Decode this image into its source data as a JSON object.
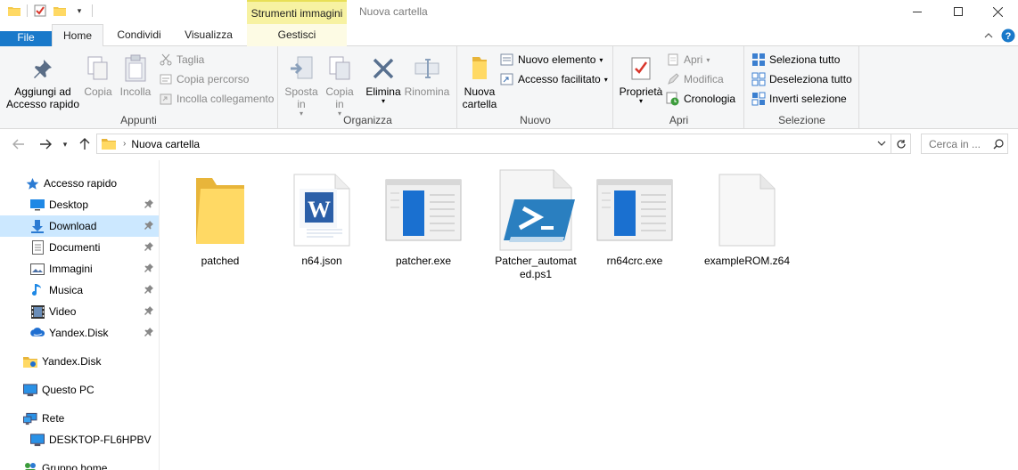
{
  "window": {
    "title": "Nuova cartella",
    "context_tab_header": "Strumenti immagini"
  },
  "tabs": [
    {
      "label": "File"
    },
    {
      "label": "Home"
    },
    {
      "label": "Condividi"
    },
    {
      "label": "Visualizza"
    },
    {
      "label": "Gestisci"
    }
  ],
  "ribbon": {
    "appunti": {
      "label": "Appunti",
      "pin": "Aggiungi ad Accesso rapido",
      "copy": "Copia",
      "paste": "Incolla",
      "cut": "Taglia",
      "copy_path": "Copia percorso",
      "paste_link": "Incolla collegamento"
    },
    "organizza": {
      "label": "Organizza",
      "move_to": "Sposta in",
      "copy_to": "Copia in",
      "delete": "Elimina",
      "rename": "Rinomina"
    },
    "nuovo": {
      "label": "Nuovo",
      "new_folder": "Nuova cartella",
      "new_item": "Nuovo elemento",
      "easy_access": "Accesso facilitato"
    },
    "apri": {
      "label": "Apri",
      "properties": "Proprietà",
      "open": "Apri",
      "edit": "Modifica",
      "history": "Cronologia"
    },
    "seleziona": {
      "label": "Selezione",
      "select_all": "Seleziona tutto",
      "select_none": "Deseleziona tutto",
      "invert": "Inverti selezione"
    }
  },
  "address": {
    "path": "Nuova cartella",
    "search_placeholder": "Cerca in ..."
  },
  "nav": {
    "quick_access": "Accesso rapido",
    "items": [
      {
        "label": "Desktop",
        "icon": "desktop-icon",
        "pinned": true
      },
      {
        "label": "Download",
        "icon": "download-icon",
        "pinned": true,
        "selected": true
      },
      {
        "label": "Documenti",
        "icon": "documents-icon",
        "pinned": true
      },
      {
        "label": "Immagini",
        "icon": "pictures-icon",
        "pinned": true
      },
      {
        "label": "Musica",
        "icon": "music-icon",
        "pinned": true
      },
      {
        "label": "Video",
        "icon": "video-icon",
        "pinned": true
      },
      {
        "label": "Yandex.Disk",
        "icon": "yandex-disk-icon",
        "pinned": true
      }
    ],
    "yandex_disk": "Yandex.Disk",
    "this_pc": "Questo PC",
    "network": "Rete",
    "desktop_pc": "DESKTOP-FL6HPBV",
    "homegroup": "Gruppo home"
  },
  "files": [
    {
      "name": "patched",
      "icon": "folder-icon"
    },
    {
      "name": "n64.json",
      "icon": "word-document-icon"
    },
    {
      "name": "patcher.exe",
      "icon": "exe-window-icon"
    },
    {
      "name": "Patcher_automated.ps1",
      "icon": "powershell-icon"
    },
    {
      "name": "rn64crc.exe",
      "icon": "exe-window-icon"
    },
    {
      "name": "exampleROM.z64",
      "icon": "blank-file-icon"
    }
  ]
}
